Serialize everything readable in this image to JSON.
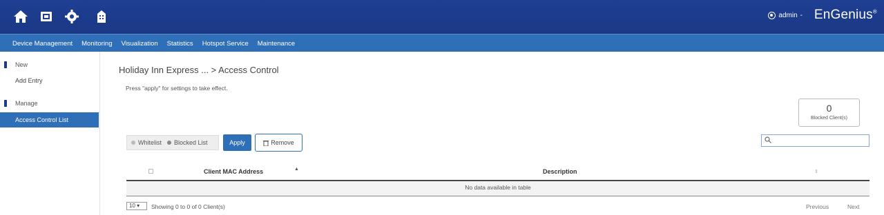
{
  "header": {
    "icons": [
      "home-icon",
      "dashboard-icon",
      "gear-icon",
      "building-icon"
    ],
    "user": "admin",
    "separator": "-",
    "brand": "EnGenius",
    "brand_mark": "®"
  },
  "nav": {
    "items": [
      "Device Management",
      "Monitoring",
      "Visualization",
      "Statistics",
      "Hotspot Service",
      "Maintenance"
    ]
  },
  "sidebar": {
    "sections": [
      {
        "title": "New",
        "items": [
          "Add Entry"
        ]
      },
      {
        "title": "Manage",
        "items": [
          "Access Control List"
        ]
      }
    ],
    "active": "Access Control List"
  },
  "main": {
    "breadcrumb": "Holiday Inn Express ... > Access Control",
    "hint": "Press \"apply\" for settings to take effect.",
    "counter": {
      "value": "0",
      "label": "Blocked Client(s)"
    },
    "filter": {
      "options": [
        "Whitelist",
        "Blocked List"
      ],
      "selected": "Blocked List"
    },
    "apply_label": "Apply",
    "remove_label": "Remove",
    "search_placeholder": "",
    "table": {
      "columns": [
        "Client MAC Address",
        "Description"
      ],
      "empty": "No data available in table"
    },
    "page_size": "10",
    "showing": "Showing 0 to 0 of 0 Client(s)",
    "prev_label": "Previous",
    "next_label": "Next"
  },
  "colors": {
    "header": "#1f3f93",
    "nav": "#2f6fb7",
    "accent": "#2f6fb7"
  }
}
